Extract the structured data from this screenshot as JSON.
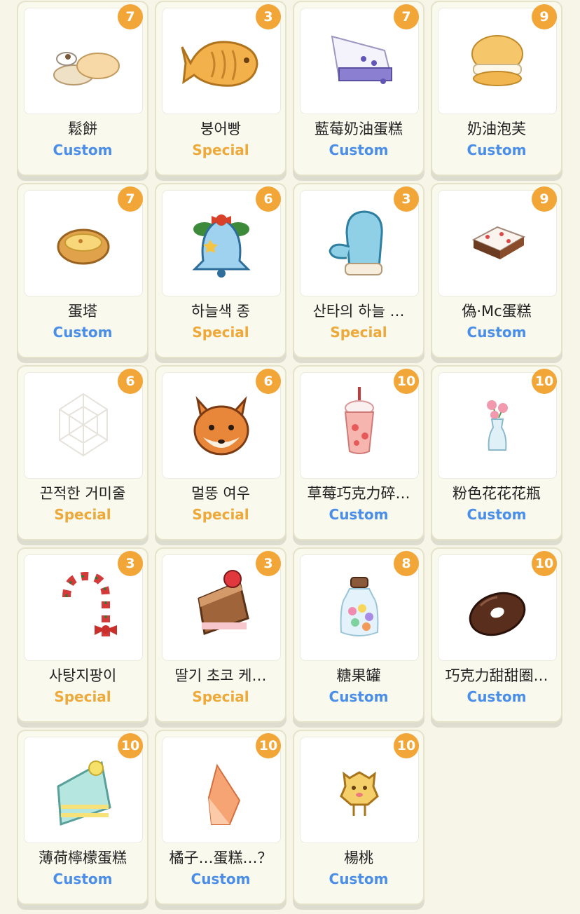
{
  "items": [
    {
      "name": "鬆餅",
      "tag": "Custom",
      "tag_type": "custom",
      "count": "7",
      "icon": "pancake-icon"
    },
    {
      "name": "붕어빵",
      "tag": "Special",
      "tag_type": "special",
      "count": "3",
      "icon": "fish-bread-icon"
    },
    {
      "name": "藍莓奶油蛋糕",
      "tag": "Custom",
      "tag_type": "custom",
      "count": "7",
      "icon": "blueberry-cake-icon"
    },
    {
      "name": "奶油泡芙",
      "tag": "Custom",
      "tag_type": "custom",
      "count": "9",
      "icon": "cream-puff-icon"
    },
    {
      "name": "蛋塔",
      "tag": "Custom",
      "tag_type": "custom",
      "count": "7",
      "icon": "egg-tart-icon"
    },
    {
      "name": "하늘색 종",
      "tag": "Special",
      "tag_type": "special",
      "count": "6",
      "icon": "sky-bell-icon"
    },
    {
      "name": "산타의 하늘 …",
      "tag": "Special",
      "tag_type": "special",
      "count": "3",
      "icon": "mitten-icon"
    },
    {
      "name": "偽·Mc蛋糕",
      "tag": "Custom",
      "tag_type": "custom",
      "count": "9",
      "icon": "mc-cake-icon"
    },
    {
      "name": "끈적한 거미줄",
      "tag": "Special",
      "tag_type": "special",
      "count": "6",
      "icon": "spider-web-icon"
    },
    {
      "name": "멀뚱 여우",
      "tag": "Special",
      "tag_type": "special",
      "count": "6",
      "icon": "fox-icon"
    },
    {
      "name": "草莓巧克力碎…",
      "tag": "Custom",
      "tag_type": "custom",
      "count": "10",
      "icon": "strawberry-shake-icon"
    },
    {
      "name": "粉色花花花瓶",
      "tag": "Custom",
      "tag_type": "custom",
      "count": "10",
      "icon": "flower-vase-icon"
    },
    {
      "name": "사탕지팡이",
      "tag": "Special",
      "tag_type": "special",
      "count": "3",
      "icon": "candy-cane-icon"
    },
    {
      "name": "딸기 초코 케…",
      "tag": "Special",
      "tag_type": "special",
      "count": "3",
      "icon": "choco-cake-slice-icon"
    },
    {
      "name": "糖果罐",
      "tag": "Custom",
      "tag_type": "custom",
      "count": "8",
      "icon": "candy-jar-icon"
    },
    {
      "name": "巧克力甜甜圈…",
      "tag": "Custom",
      "tag_type": "custom",
      "count": "10",
      "icon": "chocolate-donut-icon"
    },
    {
      "name": "薄荷檸檬蛋糕",
      "tag": "Custom",
      "tag_type": "custom",
      "count": "10",
      "icon": "mint-lemon-cake-icon"
    },
    {
      "name": "橘子…蛋糕…？",
      "tag": "Custom",
      "tag_type": "custom",
      "count": "10",
      "icon": "orange-cake-icon"
    },
    {
      "name": "楊桃",
      "tag": "Custom",
      "tag_type": "custom",
      "count": "10",
      "icon": "starfruit-icon"
    }
  ],
  "colors": {
    "background": "#f6f5e8",
    "badge": "#f2a637",
    "custom": "#4a8ee8",
    "special": "#eda93a"
  }
}
